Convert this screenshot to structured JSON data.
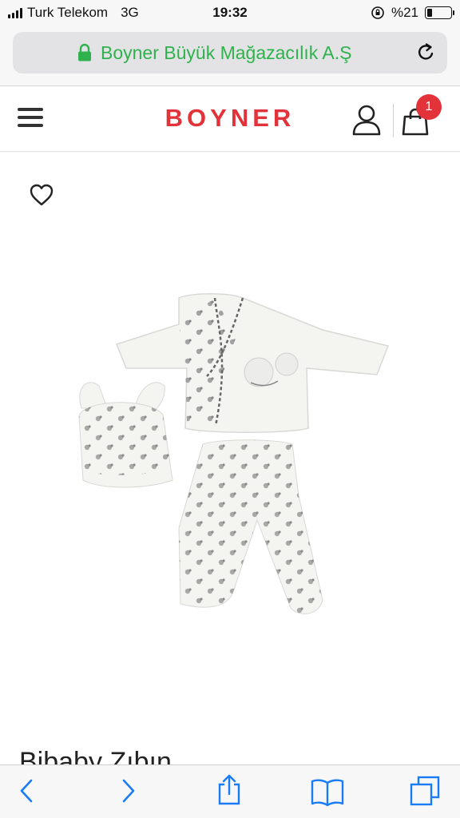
{
  "status_bar": {
    "carrier": "Turk Telekom",
    "network": "3G",
    "time": "19:32",
    "battery": "%21",
    "battery_level": 0.21
  },
  "browser": {
    "url_label": "Boyner Büyük Mağazacılık A.Ş",
    "accent_color": "#2fb24d",
    "toolbar_tint": "#1a7cf5"
  },
  "header": {
    "brand": "BOYNER",
    "brand_color": "#e2323a",
    "cart_count": "1"
  },
  "product": {
    "title": "Bibaby Zıbın"
  },
  "icons": {
    "menu": "hamburger-icon",
    "account": "user-icon",
    "cart": "shopping-bag-icon",
    "wishlist": "heart-icon",
    "back": "chevron-left-icon",
    "forward": "chevron-right-icon",
    "share": "share-icon",
    "bookmarks": "book-icon",
    "tabs": "tabs-icon"
  }
}
